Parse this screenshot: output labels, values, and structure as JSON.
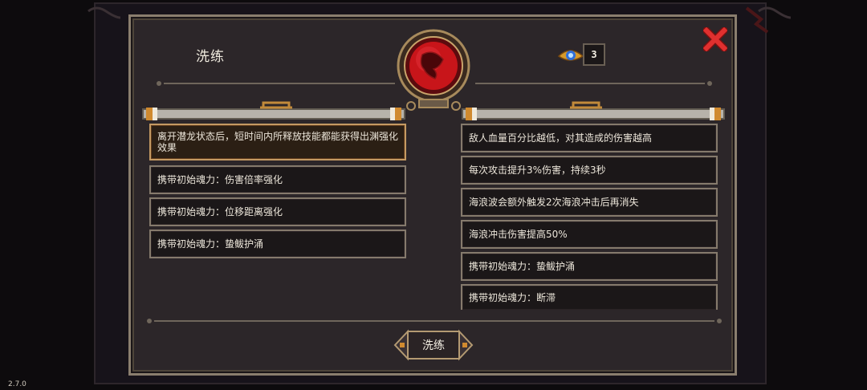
{
  "panel": {
    "title": "洗练",
    "currency_count": "3"
  },
  "left_options": [
    {
      "text": "离开潜龙状态后，短时间内所释放技能都能获得出渊强化效果",
      "selected": true
    },
    {
      "text": "携带初始魂力：伤害倍率强化",
      "selected": false
    },
    {
      "text": "携带初始魂力：位移距离强化",
      "selected": false
    },
    {
      "text": "携带初始魂力：蛰鲅护涌",
      "selected": false
    }
  ],
  "right_options": [
    {
      "text": "敌人血量百分比越低，对其造成的伤害越高"
    },
    {
      "text": "每次攻击提升3%伤害，持续3秒"
    },
    {
      "text": "海浪波会额外触发2次海浪冲击后再消失"
    },
    {
      "text": "海浪冲击伤害提高50%"
    },
    {
      "text": "携带初始魂力：蛰鲅护涌"
    },
    {
      "text": "携带初始魂力：断滞"
    }
  ],
  "action_button": "洗练",
  "version": "2.7.0",
  "colors": {
    "panel_bg": "#2c2629",
    "border": "#857a6c",
    "selected_border": "#c49a63",
    "close_red": "#d8282a",
    "emblem_red": "#c8151a"
  },
  "icons": {
    "close": "close-x-icon",
    "currency": "eye-gem-icon",
    "emblem": "dragon-emblem-icon"
  }
}
